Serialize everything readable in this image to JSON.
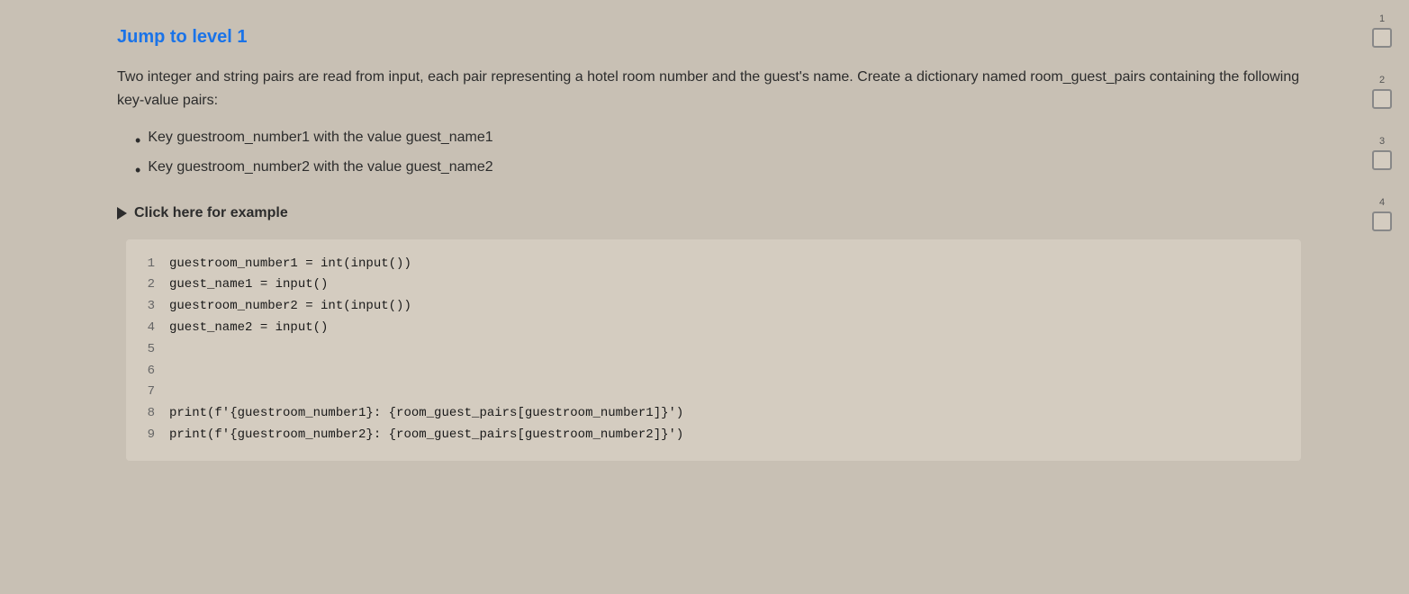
{
  "header": {
    "jump_label": "Jump to level 1"
  },
  "description": {
    "text": "Two integer and string pairs are read from input, each pair representing a hotel room number and the guest's name. Create a dictionary named room_guest_pairs containing the following key-value pairs:",
    "bullets": [
      "Key guestroom_number1 with the value guest_name1",
      "Key guestroom_number2 with the value guest_name2"
    ]
  },
  "example": {
    "toggle_label": "Click here for example"
  },
  "code": {
    "lines": [
      {
        "num": "1",
        "code": "guestroom_number1 = int(input())"
      },
      {
        "num": "2",
        "code": "guest_name1 = input()"
      },
      {
        "num": "3",
        "code": "guestroom_number2 = int(input())"
      },
      {
        "num": "4",
        "code": "guest_name2 = input()"
      },
      {
        "num": "5",
        "code": ""
      },
      {
        "num": "6",
        "code": ""
      },
      {
        "num": "7",
        "code": ""
      },
      {
        "num": "8",
        "code": "print(f'{guestroom_number1}: {room_guest_pairs[guestroom_number1]}')"
      },
      {
        "num": "9",
        "code": "print(f'{guestroom_number2}: {room_guest_pairs[guestroom_number2]}')"
      }
    ]
  },
  "sidebar": {
    "levels": [
      {
        "number": "1",
        "active": true
      },
      {
        "number": "2",
        "active": false
      },
      {
        "number": "3",
        "active": false
      },
      {
        "number": "4",
        "active": false
      }
    ]
  }
}
